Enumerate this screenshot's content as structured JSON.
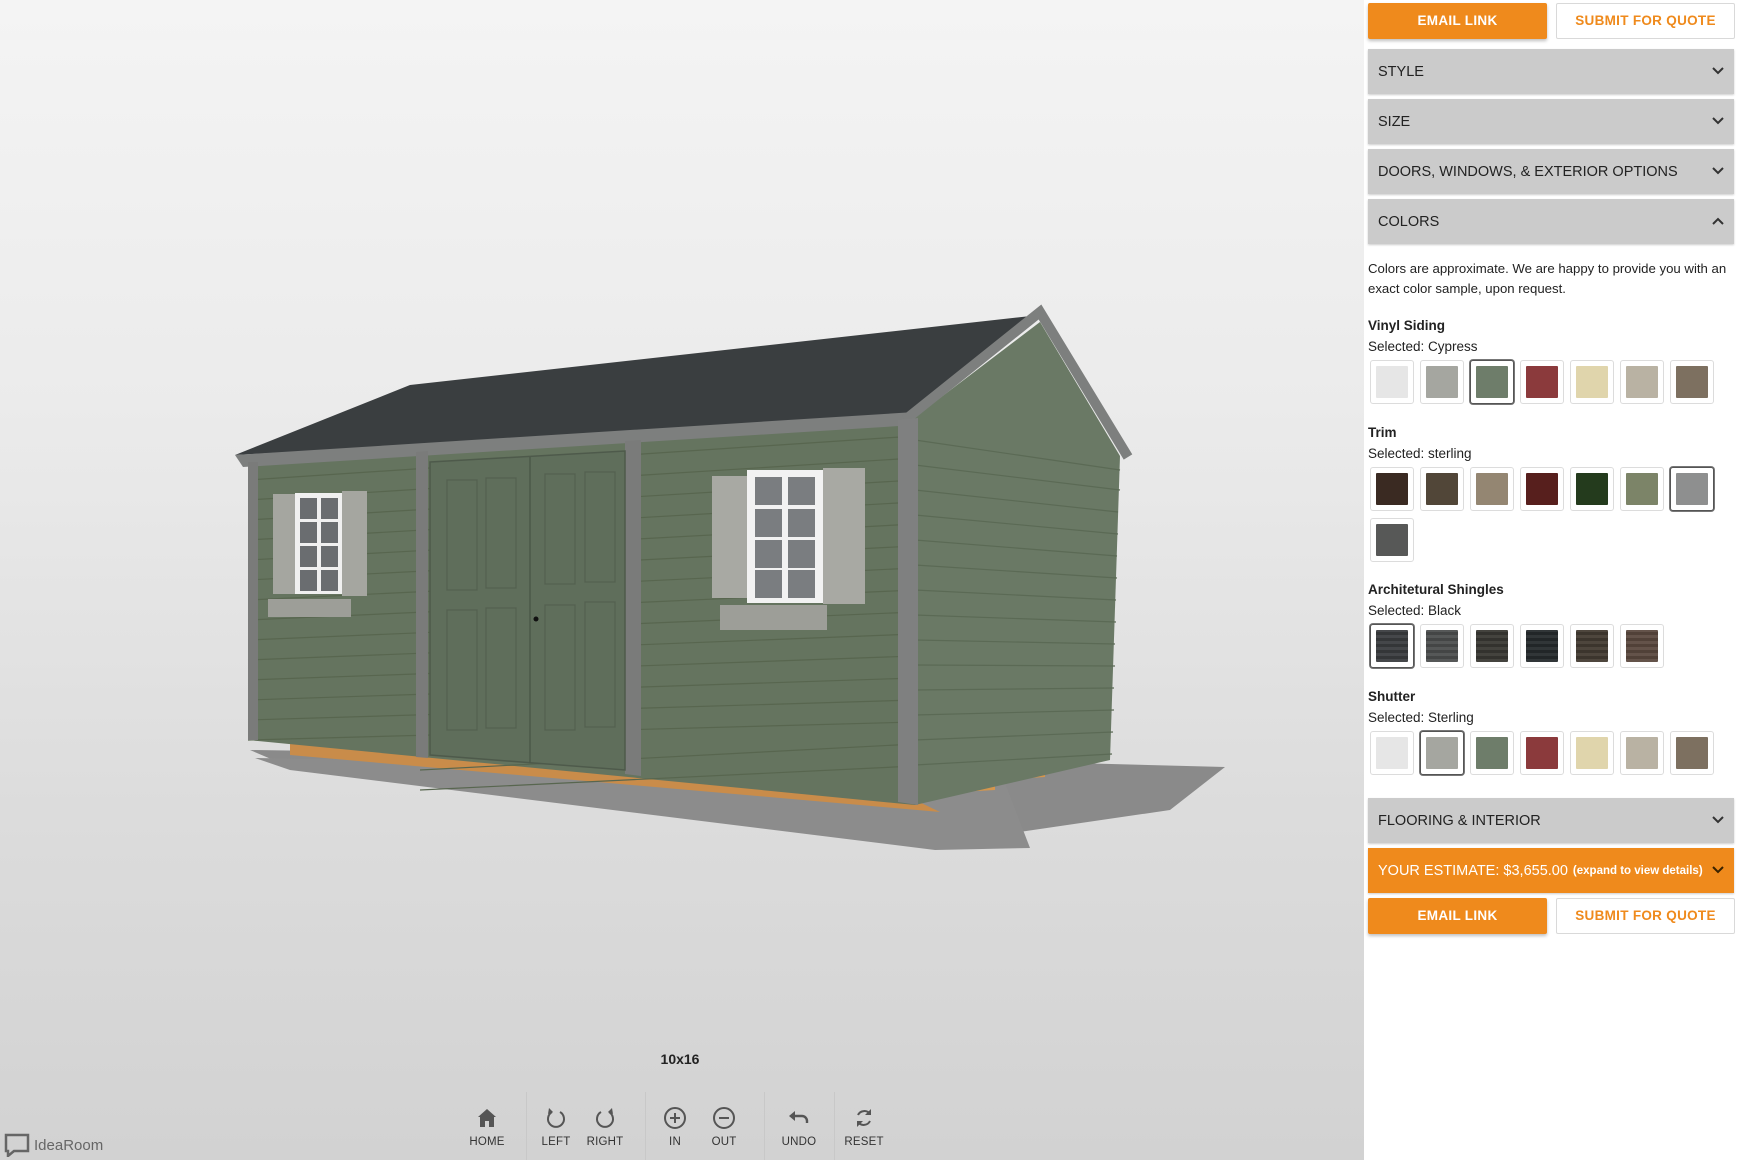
{
  "viewer": {
    "size_label": "10x16",
    "brand": "IdeaRoom",
    "toolbar": [
      {
        "label": "HOME",
        "icon": "home-icon"
      },
      {
        "label": "LEFT",
        "icon": "rotate-left-icon"
      },
      {
        "label": "RIGHT",
        "icon": "rotate-right-icon"
      },
      {
        "label": "IN",
        "icon": "zoom-in-icon"
      },
      {
        "label": "OUT",
        "icon": "zoom-out-icon"
      },
      {
        "label": "UNDO",
        "icon": "undo-icon"
      },
      {
        "label": "RESET",
        "icon": "reset-icon"
      }
    ]
  },
  "actions_top": {
    "email": "EMAIL LINK",
    "quote": "SUBMIT FOR QUOTE"
  },
  "actions_bottom": {
    "email": "EMAIL LINK",
    "quote": "SUBMIT FOR QUOTE"
  },
  "accordions": {
    "style": "STYLE",
    "size": "SIZE",
    "doors": "DOORS, WINDOWS, & EXTERIOR OPTIONS",
    "colors": "COLORS",
    "flooring": "FLOORING & INTERIOR",
    "estimate_label": "YOUR ESTIMATE: $3,655.00",
    "estimate_note": "(expand to view details)"
  },
  "colors": {
    "note": "Colors are approximate. We are happy to provide you with an exact color sample, upon request.",
    "groups": [
      {
        "title": "Vinyl Siding",
        "selected": "Selected: Cypress",
        "selected_index": 2,
        "textured": false,
        "swatches": [
          "#e6e6e6",
          "#a5a6a0",
          "#6e7d6a",
          "#8b3a3c",
          "#e0d5ac",
          "#b9b2a3",
          "#7d7060"
        ]
      },
      {
        "title": "Trim",
        "selected": "Selected: sterling",
        "selected_index": 6,
        "textured": false,
        "swatches": [
          "#3a2a22",
          "#514638",
          "#948672",
          "#571f1d",
          "#243b1d",
          "#7c8468",
          "#8e8f8f",
          "#575857"
        ]
      },
      {
        "title": "Architetural Shingles",
        "selected": "Selected: Black",
        "selected_index": 0,
        "textured": true,
        "swatches": [
          "#3b3d40",
          "#4d4f4f",
          "#3a3934",
          "#262b2d",
          "#443c33",
          "#5c4a40"
        ]
      },
      {
        "title": "Shutter",
        "selected": "Selected: Sterling",
        "selected_index": 1,
        "textured": false,
        "swatches": [
          "#e6e6e6",
          "#a5a6a0",
          "#6e7d6a",
          "#8b3a3c",
          "#e0d5ac",
          "#b9b2a3",
          "#7d7060"
        ]
      }
    ]
  }
}
